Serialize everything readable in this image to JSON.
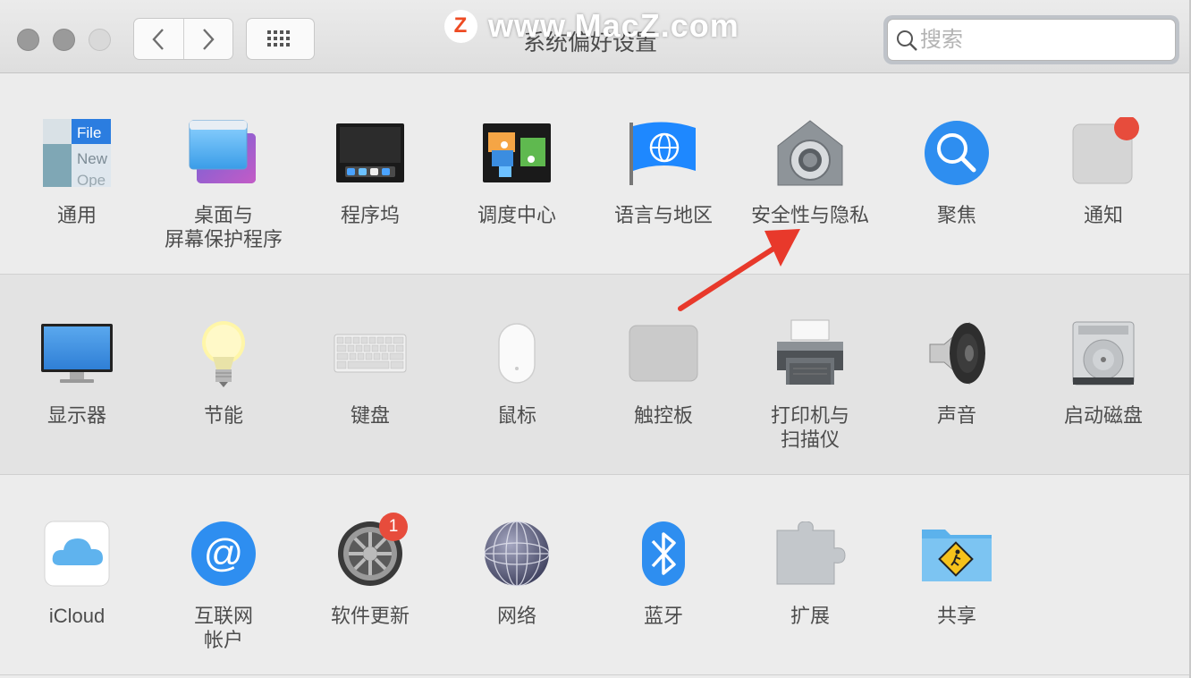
{
  "window": {
    "title": "系统偏好设置"
  },
  "watermark": {
    "badge": "Z",
    "text": "www.MacZ.com"
  },
  "search": {
    "placeholder": "搜索",
    "value": ""
  },
  "rows": [
    {
      "items": [
        {
          "label": "通用",
          "icon": "general-icon"
        },
        {
          "label": "桌面与\n屏幕保护程序",
          "icon": "desktop-screensaver-icon"
        },
        {
          "label": "程序坞",
          "icon": "dock-icon"
        },
        {
          "label": "调度中心",
          "icon": "mission-control-icon"
        },
        {
          "label": "语言与地区",
          "icon": "language-region-icon"
        },
        {
          "label": "安全性与隐私",
          "icon": "security-privacy-icon"
        },
        {
          "label": "聚焦",
          "icon": "spotlight-icon"
        },
        {
          "label": "通知",
          "icon": "notifications-icon"
        }
      ]
    },
    {
      "items": [
        {
          "label": "显示器",
          "icon": "displays-icon"
        },
        {
          "label": "节能",
          "icon": "energy-saver-icon"
        },
        {
          "label": "键盘",
          "icon": "keyboard-icon"
        },
        {
          "label": "鼠标",
          "icon": "mouse-icon"
        },
        {
          "label": "触控板",
          "icon": "trackpad-icon"
        },
        {
          "label": "打印机与\n扫描仪",
          "icon": "printers-scanners-icon"
        },
        {
          "label": "声音",
          "icon": "sound-icon"
        },
        {
          "label": "启动磁盘",
          "icon": "startup-disk-icon"
        }
      ]
    },
    {
      "items": [
        {
          "label": "iCloud",
          "icon": "icloud-icon"
        },
        {
          "label": "互联网\n帐户",
          "icon": "internet-accounts-icon"
        },
        {
          "label": "软件更新",
          "icon": "software-update-icon",
          "badge": "1"
        },
        {
          "label": "网络",
          "icon": "network-icon"
        },
        {
          "label": "蓝牙",
          "icon": "bluetooth-icon"
        },
        {
          "label": "扩展",
          "icon": "extensions-icon"
        },
        {
          "label": "共享",
          "icon": "sharing-icon"
        }
      ]
    }
  ],
  "general_icon_text": {
    "line1": "File",
    "line2": "New",
    "line3": "Ope"
  },
  "colors": {
    "accent": "#1e88ff",
    "badge": "#e74c3c",
    "arrow": "#e8392b"
  }
}
